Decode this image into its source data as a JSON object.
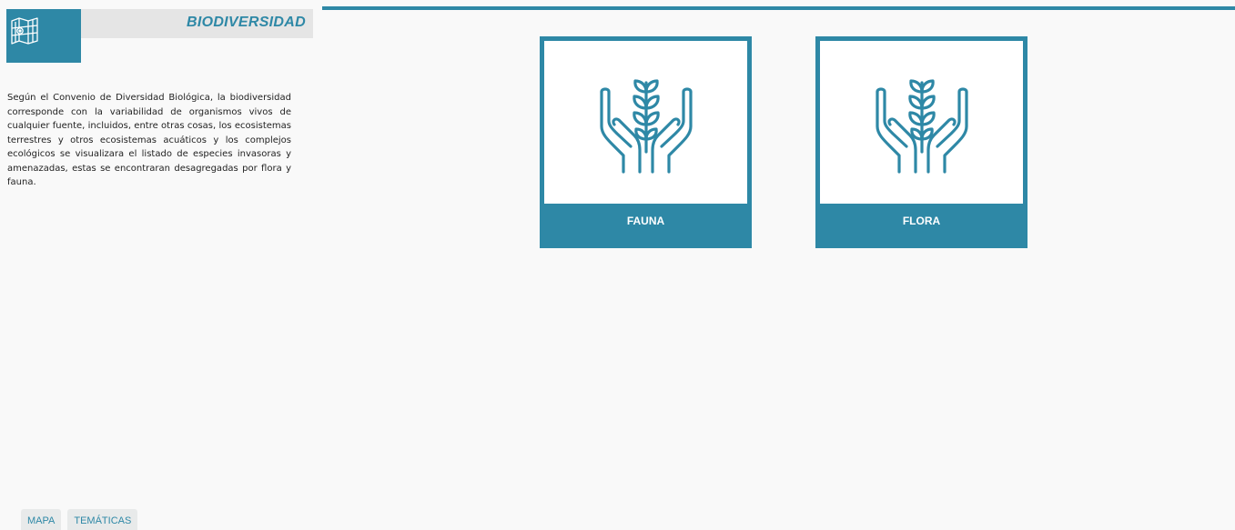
{
  "header": {
    "title": "BIODIVERSIDAD",
    "icon": "map-icon"
  },
  "description": "Según el Convenio de Diversidad Biológica, la biodiversidad corresponde con la variabilidad de organismos vivos de cualquier fuente, incluidos, entre otras cosas, los ecosistemas terrestres y otros ecosistemas acuáticos y los complejos ecológicos se visualizara el listado de especies invasoras y amenazadas, estas se encontraran desagregadas por flora y fauna.",
  "cards": [
    {
      "label": "FAUNA",
      "icon": "hands-plant-icon"
    },
    {
      "label": "FLORA",
      "icon": "hands-plant-icon"
    }
  ],
  "tabs": [
    {
      "label": "MAPA"
    },
    {
      "label": "TEMÁTICAS"
    }
  ],
  "colors": {
    "accent": "#2e88a6",
    "title_bg": "#e5e5e5",
    "background": "#f9f9f9"
  }
}
